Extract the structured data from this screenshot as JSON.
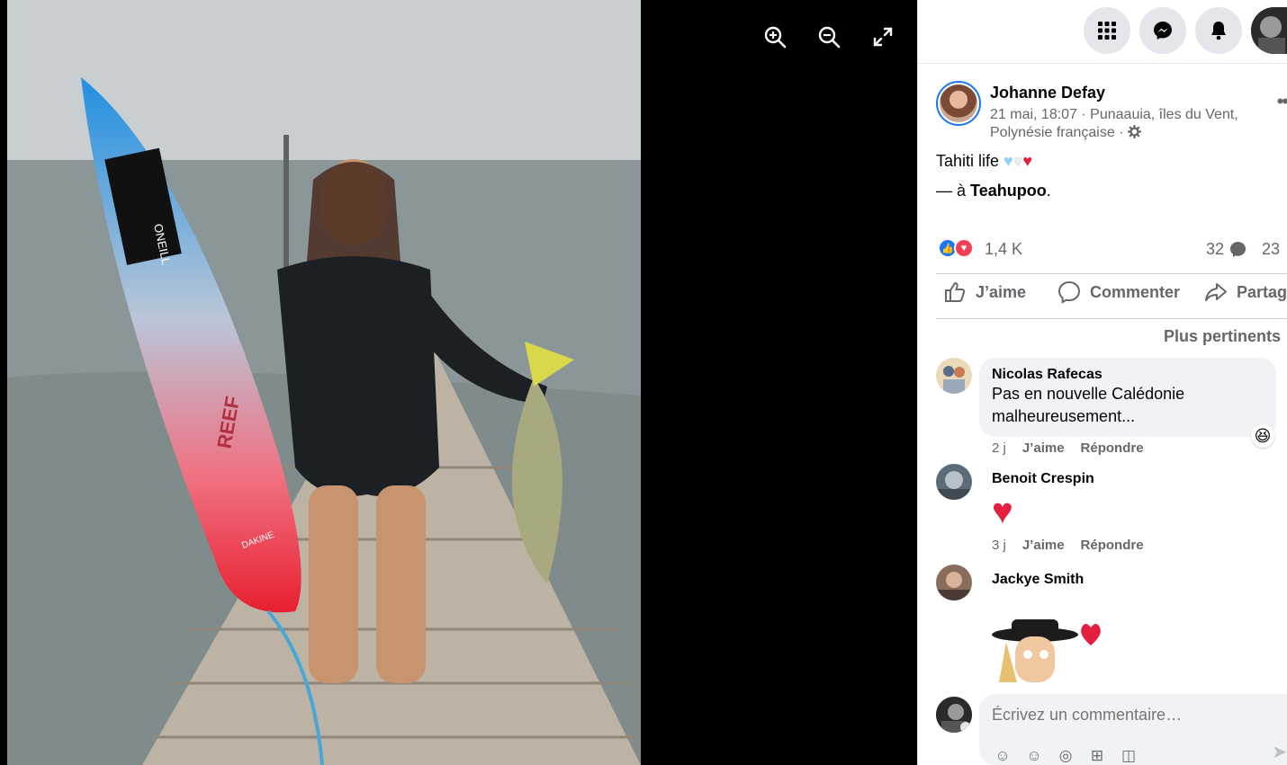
{
  "viewer": {
    "tools": [
      {
        "name": "zoom-in-icon"
      },
      {
        "name": "zoom-out-icon"
      },
      {
        "name": "fullscreen-icon"
      }
    ],
    "photo_brand_1": "ONEILL",
    "photo_brand_2": "REEF",
    "photo_brand_3": "DAKINE"
  },
  "topbar": {
    "icons": [
      "menu-grid-icon",
      "messenger-icon",
      "notifications-icon"
    ]
  },
  "post": {
    "author": "Johanne Defay",
    "meta": "21 mai, 18:07 · Punaauia, îles du Vent, Polynésie française ·",
    "text": "Tahiti life",
    "location_prefix": "— à",
    "location": "Teahupoo",
    "location_suffix": ".",
    "reactions_count": "1,4 K",
    "comments_count": "32",
    "shares_count": "23",
    "actions": {
      "like": "J’aime",
      "comment": "Commenter",
      "share": "Partag"
    },
    "sort_label": "Plus pertinents"
  },
  "comments": [
    {
      "name": "Nicolas Rafecas",
      "text": "Pas en nouvelle Calédonie malheureusement...",
      "time": "2 j",
      "like": "J’aime",
      "reply": "Répondre"
    },
    {
      "name": "Benoit Crespin",
      "text": "",
      "time": "3 j",
      "like": "J’aime",
      "reply": "Répondre"
    },
    {
      "name": "Jackye Smith"
    }
  ],
  "composer": {
    "placeholder": "Écrivez un commentaire…"
  },
  "colors": {
    "accent": "#1877f2",
    "love": "#f33e58",
    "heart": "#e41e3f"
  }
}
